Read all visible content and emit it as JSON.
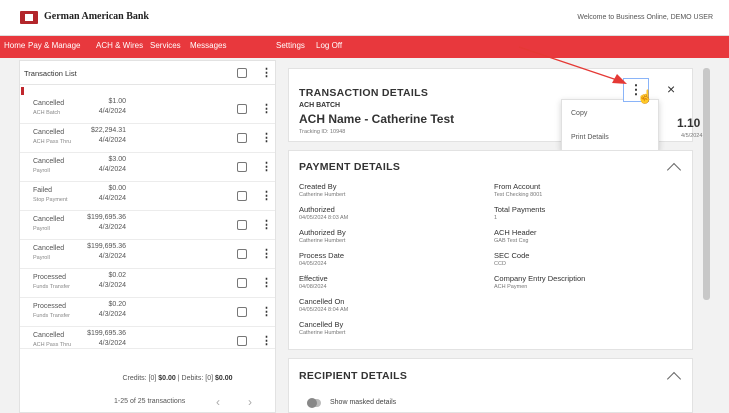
{
  "header": {
    "bank_name": "German American Bank",
    "welcome": "Welcome to Business Online, DEMO USER",
    "brand_color": "#e8383d"
  },
  "nav": {
    "items": [
      "Home",
      "Pay & Manage",
      "ACH & Wires",
      "Services",
      "Messages",
      "Settings",
      "Log Off"
    ]
  },
  "transaction_list": {
    "title": "Transaction List",
    "rows": [
      {
        "status": "Cancelled",
        "type": "ACH Batch",
        "amount": "$1.00",
        "date": "4/4/2024"
      },
      {
        "status": "Cancelled",
        "type": "ACH Pass Thru",
        "amount": "$22,294.31",
        "date": "4/4/2024"
      },
      {
        "status": "Cancelled",
        "type": "Payroll",
        "amount": "$3.00",
        "date": "4/4/2024"
      },
      {
        "status": "Failed",
        "type": "Stop Payment",
        "amount": "$0.00",
        "date": "4/4/2024"
      },
      {
        "status": "Cancelled",
        "type": "Payroll",
        "amount": "$199,695.36",
        "date": "4/3/2024"
      },
      {
        "status": "Cancelled",
        "type": "Payroll",
        "amount": "$199,695.36",
        "date": "4/3/2024"
      },
      {
        "status": "Processed",
        "type": "Funds Transfer",
        "amount": "$0.02",
        "date": "4/3/2024"
      },
      {
        "status": "Processed",
        "type": "Funds Transfer",
        "amount": "$0.20",
        "date": "4/3/2024"
      },
      {
        "status": "Cancelled",
        "type": "ACH Pass Thru",
        "amount": "$199,695.36",
        "date": "4/3/2024"
      }
    ],
    "totals_prefix": "Credits: [0] ",
    "credits_amount": "$0.00",
    "totals_mid": " | Debits: [0] ",
    "debits_amount": "$0.00",
    "pager_text": "1-25 of 25 transactions",
    "prev_icon": "‹",
    "next_icon": "›"
  },
  "transaction_details": {
    "title": "TRANSACTION DETAILS",
    "kind": "ACH BATCH",
    "name": "ACH Name - Catherine Test",
    "tracking": "Tracking ID: 10948",
    "amount_partial": "1.10",
    "date_partial": "4/5/2024",
    "more_icon": "⋮",
    "close_icon": "×",
    "menu": {
      "copy": "Copy",
      "print": "Print Details"
    }
  },
  "payment_details": {
    "title": "PAYMENT DETAILS",
    "left": [
      {
        "label": "Created By",
        "value": "Catherine Humbert"
      },
      {
        "label": "Authorized",
        "value": "04/05/2024 8:03 AM"
      },
      {
        "label": "Authorized By",
        "value": "Catherine Humbert"
      },
      {
        "label": "Process Date",
        "value": "04/05/2024"
      },
      {
        "label": "Effective",
        "value": "04/08/2024"
      },
      {
        "label": "Cancelled On",
        "value": "04/05/2024 8:04 AM"
      },
      {
        "label": "Cancelled By",
        "value": "Catherine Humbert"
      }
    ],
    "right": [
      {
        "label": "From Account",
        "value": "Test Checking 8001"
      },
      {
        "label": "Total Payments",
        "value": "1"
      },
      {
        "label": "ACH Header",
        "value": "GAB Test Cxg"
      },
      {
        "label": "SEC Code",
        "value": "CCD"
      },
      {
        "label": "Company Entry Description",
        "value": "ACH Paymen"
      }
    ]
  },
  "recipient_details": {
    "title": "RECIPIENT DETAILS",
    "mask_label": "Show masked details"
  },
  "annotation_color": "#e53935"
}
